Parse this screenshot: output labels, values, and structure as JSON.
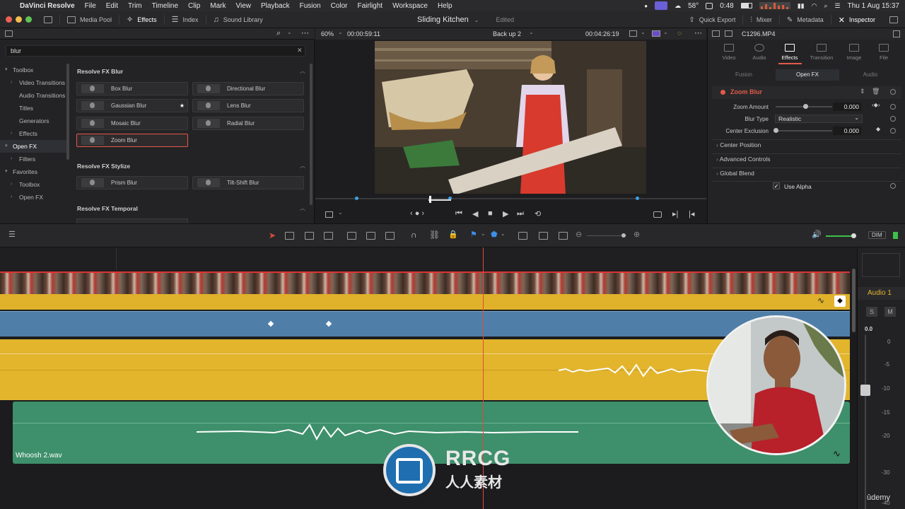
{
  "menubar": {
    "app_name": "DaVinci Resolve",
    "items": [
      "File",
      "Edit",
      "Trim",
      "Timeline",
      "Clip",
      "Mark",
      "View",
      "Playback",
      "Fusion",
      "Color",
      "Fairlight",
      "Workspace",
      "Help"
    ],
    "temperature": "58°",
    "timer": "0:48",
    "datetime": "Thu 1 Aug  15:37"
  },
  "toolbar": {
    "media_pool": "Media Pool",
    "effects": "Effects",
    "index": "Index",
    "sound_library": "Sound Library",
    "project_title": "Sliding Kitchen",
    "edited": "Edited",
    "quick_export": "Quick Export",
    "mixer": "Mixer",
    "metadata": "Metadata",
    "inspector": "Inspector"
  },
  "effects_panel": {
    "search_value": "blur",
    "tree": [
      {
        "label": "Toolbox",
        "level": 0,
        "caret": "▾"
      },
      {
        "label": "Video Transitions",
        "level": 1,
        "caret": "›"
      },
      {
        "label": "Audio Transitions",
        "level": 1,
        "caret": ""
      },
      {
        "label": "Titles",
        "level": 1,
        "caret": ""
      },
      {
        "label": "Generators",
        "level": 1,
        "caret": ""
      },
      {
        "label": "Effects",
        "level": 1,
        "caret": "›"
      },
      {
        "label": "Open FX",
        "level": 0,
        "caret": "▾",
        "selected": true
      },
      {
        "label": "Filters",
        "level": 1,
        "caret": "›"
      },
      {
        "label": "Favorites",
        "level": 0,
        "caret": "▾"
      },
      {
        "label": "Toolbox",
        "level": 1,
        "caret": "›"
      },
      {
        "label": "Open FX",
        "level": 1,
        "caret": "›"
      }
    ],
    "sections": [
      {
        "title": "Resolve FX Blur",
        "items": [
          "Box Blur",
          "Directional Blur",
          "Gaussian Blur",
          "Lens Blur",
          "Mosaic Blur",
          "Radial Blur",
          "Zoom Blur"
        ]
      },
      {
        "title": "Resolve FX Stylize",
        "items": [
          "Prism Blur",
          "Tilt-Shift Blur"
        ]
      },
      {
        "title": "Resolve FX Temporal",
        "items": []
      }
    ],
    "favorite_mark": "★"
  },
  "viewer": {
    "zoom": "60%",
    "source_duration": "00:00:59:11",
    "timeline_name": "Back up 2",
    "timecode": "00:04:26:19"
  },
  "inspector": {
    "clip_name": "C1296.MP4",
    "tabs": [
      "Video",
      "Audio",
      "Effects",
      "Transition",
      "Image",
      "File"
    ],
    "active_tab": "Effects",
    "sub_tabs": [
      "Fusion",
      "Open FX",
      "Audio"
    ],
    "active_sub_tab": "Open FX",
    "effect_name": "Zoom Blur",
    "params": {
      "zoom_amount_label": "Zoom Amount",
      "zoom_amount": "0.000",
      "blur_type_label": "Blur Type",
      "blur_type": "Realistic",
      "center_exclusion_label": "Center Exclusion",
      "center_exclusion": "0.000"
    },
    "groups": [
      "Center Position",
      "Advanced Controls",
      "Global Blend"
    ],
    "use_alpha": "Use Alpha",
    "use_alpha_mark": "✓"
  },
  "timeline": {
    "audio_clip_name": "Whoosh 2.wav",
    "dim_label": "DIM"
  },
  "mixer": {
    "track_name": "Audio 1",
    "solo": "S",
    "mute": "M",
    "level": "0.0",
    "scale": [
      "0",
      "-5",
      "-10",
      "-15",
      "-20",
      "-30",
      "-40"
    ]
  },
  "watermark": {
    "brand": "RRCG",
    "chinese": "人人素材",
    "udemy": "ûdemy"
  },
  "colors": {
    "accent_red": "#e35a4a",
    "clip_yellow": "#e3b52d",
    "clip_blue": "#4f7fa8",
    "clip_green": "#3e8f6b",
    "playhead": "#e04a3a"
  }
}
